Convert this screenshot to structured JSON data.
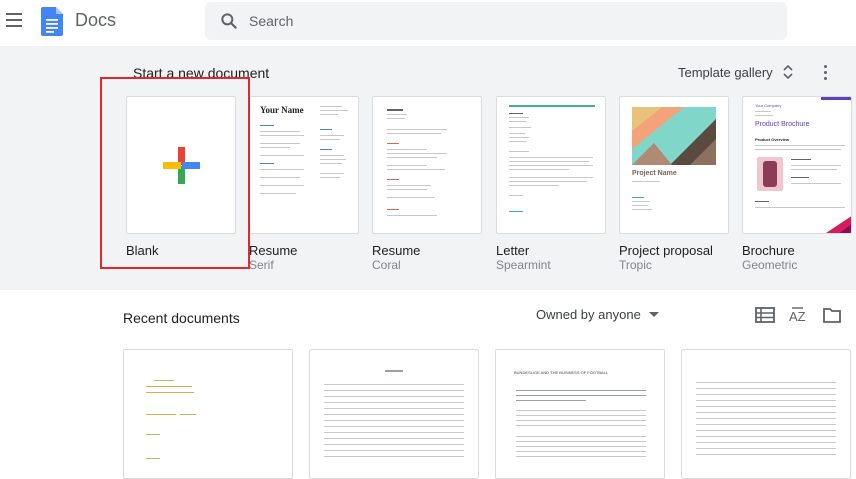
{
  "header": {
    "app_title": "Docs",
    "search_placeholder": "Search"
  },
  "templates": {
    "section_title": "Start a new document",
    "gallery_label": "Template gallery",
    "items": [
      {
        "name": "Blank",
        "subtitle": ""
      },
      {
        "name": "Resume",
        "subtitle": "Serif"
      },
      {
        "name": "Resume",
        "subtitle": "Coral"
      },
      {
        "name": "Letter",
        "subtitle": "Spearmint"
      },
      {
        "name": "Project proposal",
        "subtitle": "Tropic"
      },
      {
        "name": "Brochure",
        "subtitle": "Geometric"
      }
    ],
    "serif_heading": "Your Name",
    "project_heading": "Project Name",
    "brochure_heading": "Product Brochure",
    "brochure_company": "Your Company",
    "brochure_overview": "Product Overview"
  },
  "recent": {
    "section_title": "Recent documents",
    "owner_filter": "Owned by anyone",
    "doc3_heading": "BUNDESLIGE AND THE BUSINESS OF FOOTBALL"
  },
  "colors": {
    "google_blue": "#4285f4",
    "google_red": "#ea4335",
    "google_yellow": "#fbbc04",
    "google_green": "#34a853",
    "highlight": "#e0292f"
  }
}
